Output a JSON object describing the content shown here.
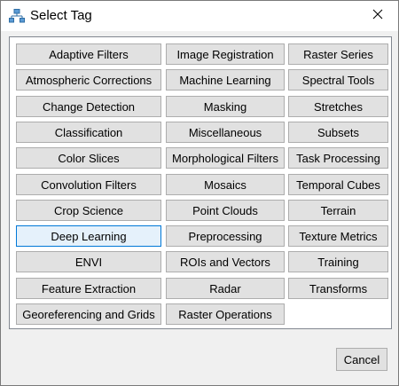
{
  "window": {
    "title": "Select Tag",
    "icon": "tag-tree-icon",
    "close_icon": "close-icon"
  },
  "tags": {
    "columns": [
      [
        "Adaptive Filters",
        "Atmospheric Corrections",
        "Change Detection",
        "Classification",
        "Color Slices",
        "Convolution Filters",
        "Crop Science",
        "Deep Learning",
        "ENVI",
        "Feature Extraction",
        "Georeferencing and Grids"
      ],
      [
        "Image Registration",
        "Machine Learning",
        "Masking",
        "Miscellaneous",
        "Morphological Filters",
        "Mosaics",
        "Point Clouds",
        "Preprocessing",
        "ROIs and Vectors",
        "Radar",
        "Raster Operations"
      ],
      [
        "Raster Series",
        "Spectral Tools",
        "Stretches",
        "Subsets",
        "Task Processing",
        "Temporal Cubes",
        "Terrain",
        "Texture Metrics",
        "Training",
        "Transforms"
      ]
    ],
    "selected": "Deep Learning"
  },
  "footer": {
    "cancel_label": "Cancel"
  },
  "colors": {
    "button_bg": "#e1e1e1",
    "button_border": "#adadad",
    "selected_bg": "#e5f1fb",
    "selected_border": "#0078d7"
  }
}
